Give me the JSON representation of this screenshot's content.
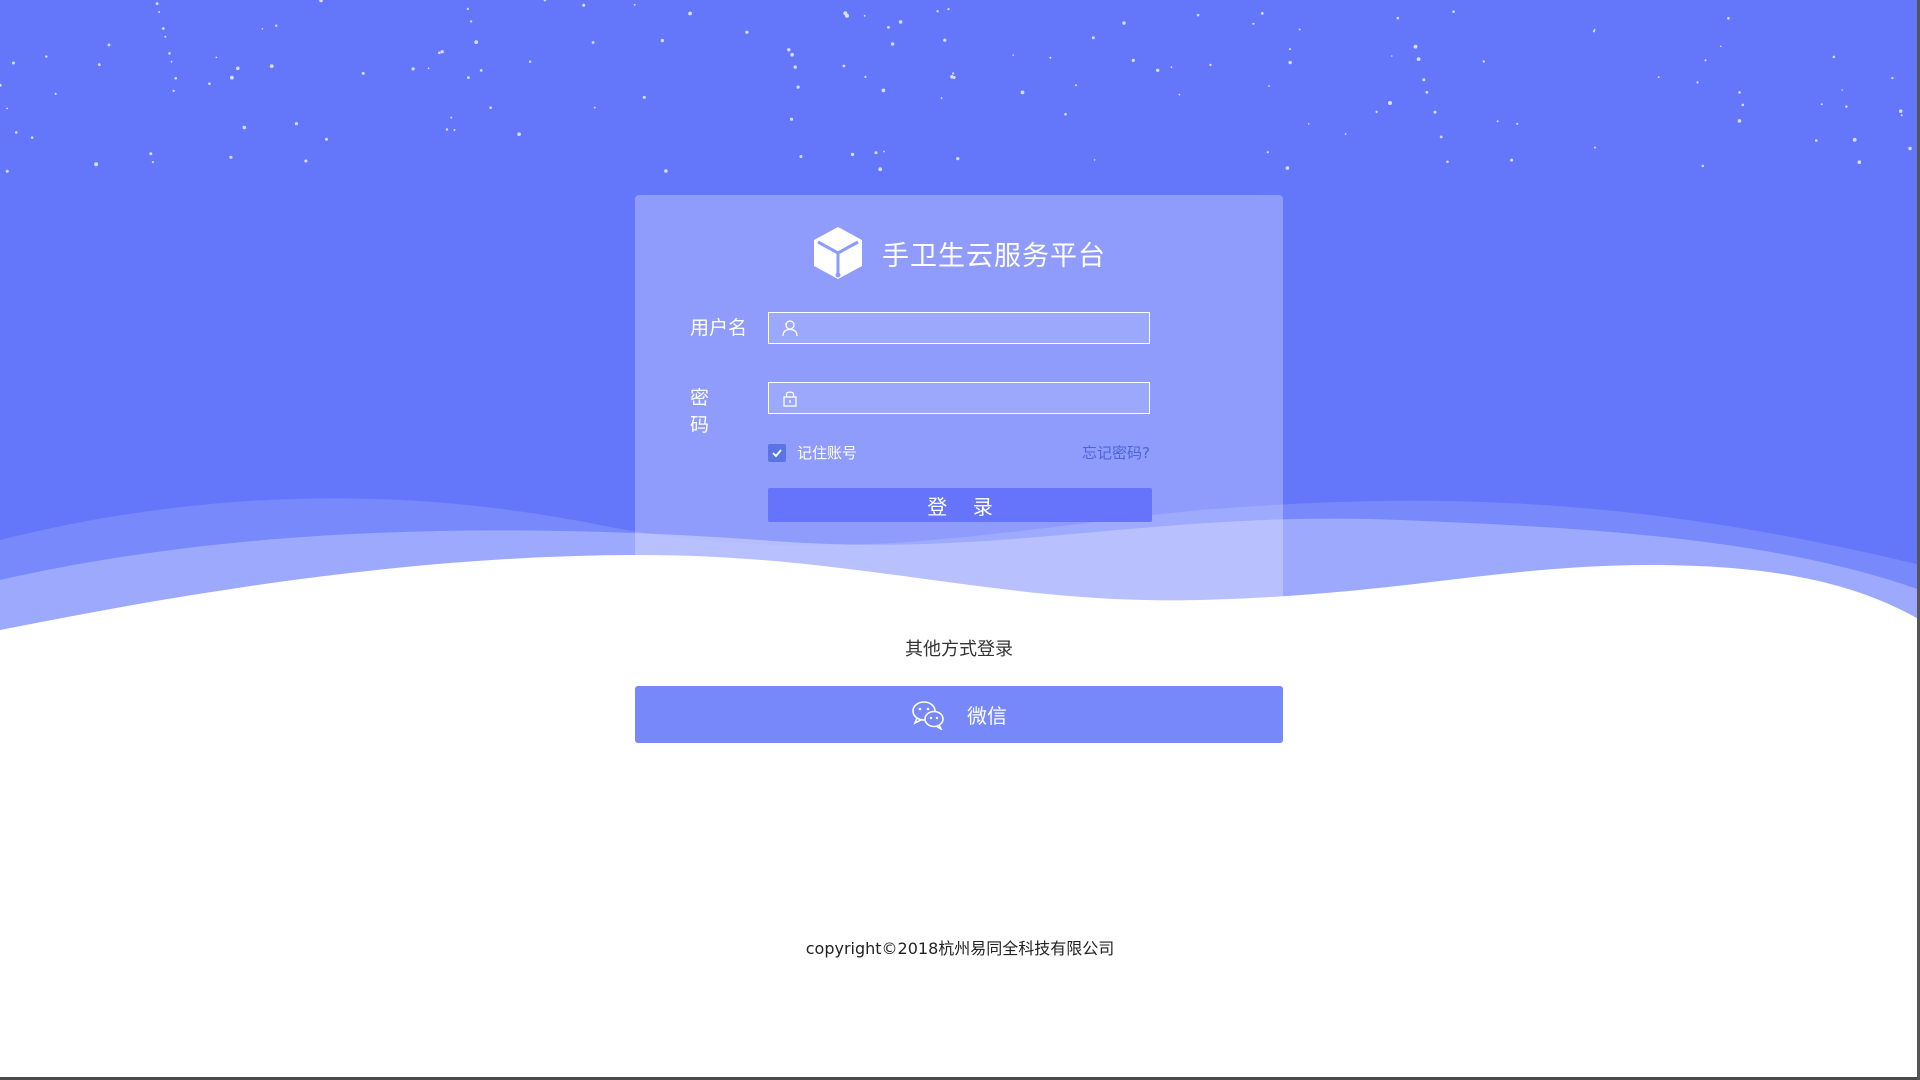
{
  "colors": {
    "sky": "#6477fb",
    "card_button": "#6574fb",
    "checkbox": "#5a73e6",
    "forgot_link": "#4d63d8",
    "wechat_button": "#7788fb"
  },
  "brand": {
    "logo_icon": "cube-icon",
    "title": "手卫生云服务平台"
  },
  "form": {
    "username_label": "用户名",
    "username_icon": "user-icon",
    "username_value": "",
    "password_label": "密 码",
    "password_icon": "lock-icon",
    "password_value": "",
    "remember_checked": true,
    "remember_label": "记住账号",
    "forgot_label": "忘记密码?",
    "login_label": "登 录"
  },
  "other": {
    "title": "其他方式登录",
    "wechat_icon": "wechat-icon",
    "wechat_label": "微信"
  },
  "footer": {
    "copyright": "copyright©2018杭州易同全科技有限公司"
  }
}
